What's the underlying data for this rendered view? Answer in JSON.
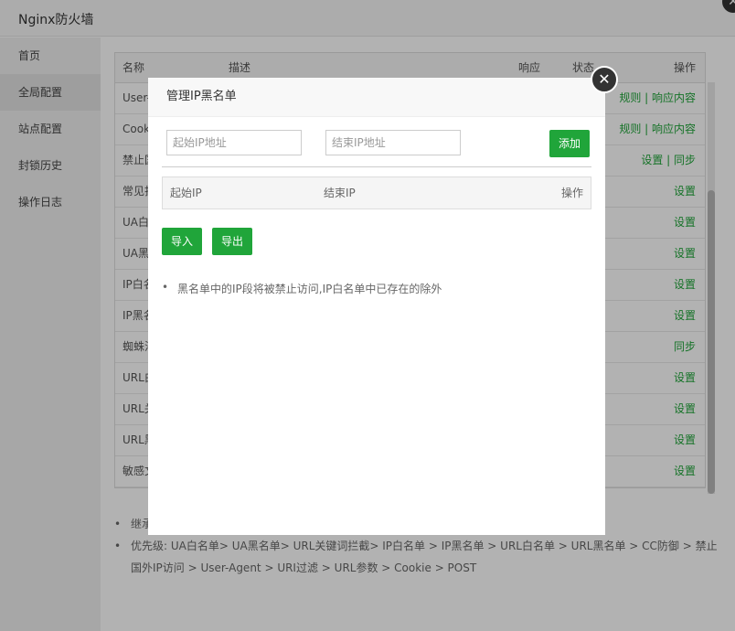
{
  "window": {
    "title": "Nginx防火墙"
  },
  "sidebar": {
    "items": [
      {
        "label": "首页"
      },
      {
        "label": "全局配置"
      },
      {
        "label": "站点配置"
      },
      {
        "label": "封锁历史"
      },
      {
        "label": "操作日志"
      }
    ]
  },
  "table": {
    "headers": {
      "name": "名称",
      "desc": "描述",
      "resp": "响应",
      "status": "状态",
      "ops": "操作"
    },
    "rows": [
      {
        "name": "User-",
        "ops": "规则 | 响应内容"
      },
      {
        "name": "Cook",
        "ops": "规则 | 响应内容"
      },
      {
        "name": "禁止国",
        "ops": "设置 | 同步"
      },
      {
        "name": "常见扫",
        "ops": "设置"
      },
      {
        "name": "UA白",
        "ops": "设置"
      },
      {
        "name": "UA黑",
        "ops": "设置"
      },
      {
        "name": "IP白名",
        "ops": "设置"
      },
      {
        "name": "IP黑名",
        "ops": "设置"
      },
      {
        "name": "蜘蛛池",
        "ops": "同步"
      },
      {
        "name": "URL白",
        "ops": "设置"
      },
      {
        "name": "URL关",
        "ops": "设置"
      },
      {
        "name": "URL黑",
        "ops": "设置"
      },
      {
        "name": "敏感文",
        "ops": "设置"
      }
    ]
  },
  "notes": [
    "继承",
    "优先级: UA白名单> UA黑名单> URL关键词拦截> IP白名单 > IP黑名单 > URL白名单 > URL黑名单 > CC防御 > 禁止国外IP访问 > User-Agent > URI过滤 > URL参数 > Cookie > POST"
  ],
  "dialog": {
    "title": "管理IP黑名单",
    "start_placeholder": "起始IP地址",
    "end_placeholder": "结束IP地址",
    "add_label": "添加",
    "col_start": "起始IP",
    "col_end": "结束IP",
    "col_ops": "操作",
    "import_label": "导入",
    "export_label": "导出",
    "note": "黑名单中的IP段将被禁止访问,IP白名单中已存在的除外"
  },
  "colors": {
    "accent": "#20a53a"
  }
}
